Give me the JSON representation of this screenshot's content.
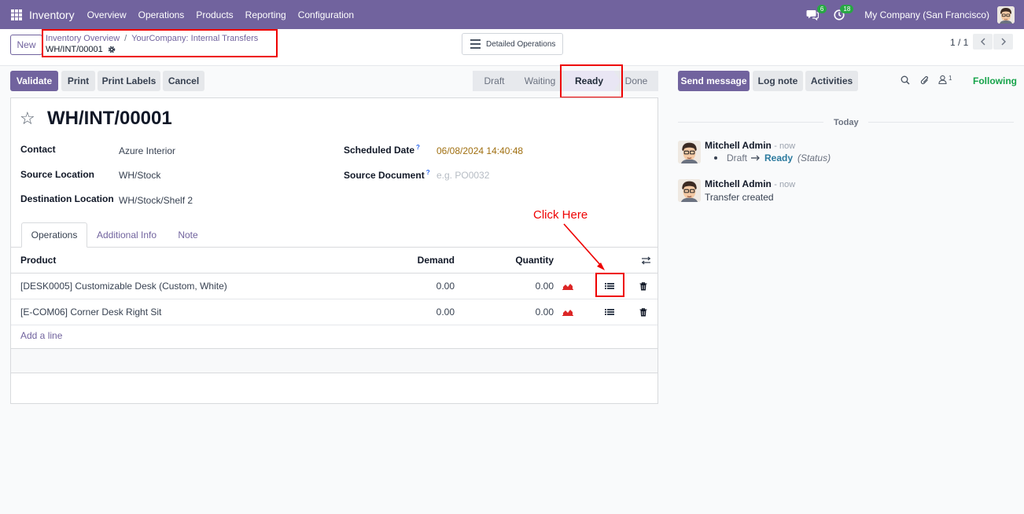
{
  "navbar": {
    "app_name": "Inventory",
    "menu": [
      "Overview",
      "Operations",
      "Products",
      "Reporting",
      "Configuration"
    ],
    "messages_count": "6",
    "activities_count": "18",
    "company": "My Company (San Francisco)",
    "color": "#71639e"
  },
  "control_panel": {
    "new_label": "New",
    "breadcrumb": [
      "Inventory Overview",
      "YourCompany: Internal Transfers"
    ],
    "breadcrumb_sep": "/",
    "record_name": "WH/INT/00001",
    "detailed_operations_label": "Detailed Operations",
    "pager": "1 / 1"
  },
  "actions": {
    "validate": "Validate",
    "print": "Print",
    "print_labels": "Print Labels",
    "cancel": "Cancel"
  },
  "statusbar": {
    "steps": [
      "Draft",
      "Waiting",
      "Ready",
      "Done"
    ],
    "active": "Ready"
  },
  "form": {
    "title": "WH/INT/00001",
    "contact_label": "Contact",
    "contact_value": "Azure Interior",
    "source_location_label": "Source Location",
    "source_location_value": "WH/Stock",
    "destination_location_label": "Destination Location",
    "destination_location_value": "WH/Stock/Shelf 2",
    "scheduled_date_label": "Scheduled Date",
    "scheduled_date_value": "06/08/2024 14:40:48",
    "source_document_label": "Source Document",
    "source_document_placeholder": "e.g. PO0032",
    "help_mark": "?"
  },
  "tabs": [
    "Operations",
    "Additional Info",
    "Note"
  ],
  "operations_table": {
    "headers": {
      "product": "Product",
      "demand": "Demand",
      "quantity": "Quantity"
    },
    "rows": [
      {
        "product": "[DESK0005] Customizable Desk (Custom, White)",
        "demand": "0.00",
        "quantity": "0.00"
      },
      {
        "product": "[E-COM06] Corner Desk Right Sit",
        "demand": "0.00",
        "quantity": "0.00"
      }
    ],
    "add_line": "Add a line"
  },
  "annotation": {
    "callout": "Click Here",
    "color": "#ee0000"
  },
  "chatter": {
    "send_message": "Send message",
    "log_note": "Log note",
    "activities": "Activities",
    "followers_count": "1",
    "following": "Following",
    "today": "Today",
    "messages": [
      {
        "author": "Mitchell Admin",
        "time": "- now",
        "tracking": {
          "old": "Draft",
          "new": "Ready",
          "field": "(Status)"
        }
      },
      {
        "author": "Mitchell Admin",
        "time": "- now",
        "body": "Transfer created"
      }
    ]
  }
}
